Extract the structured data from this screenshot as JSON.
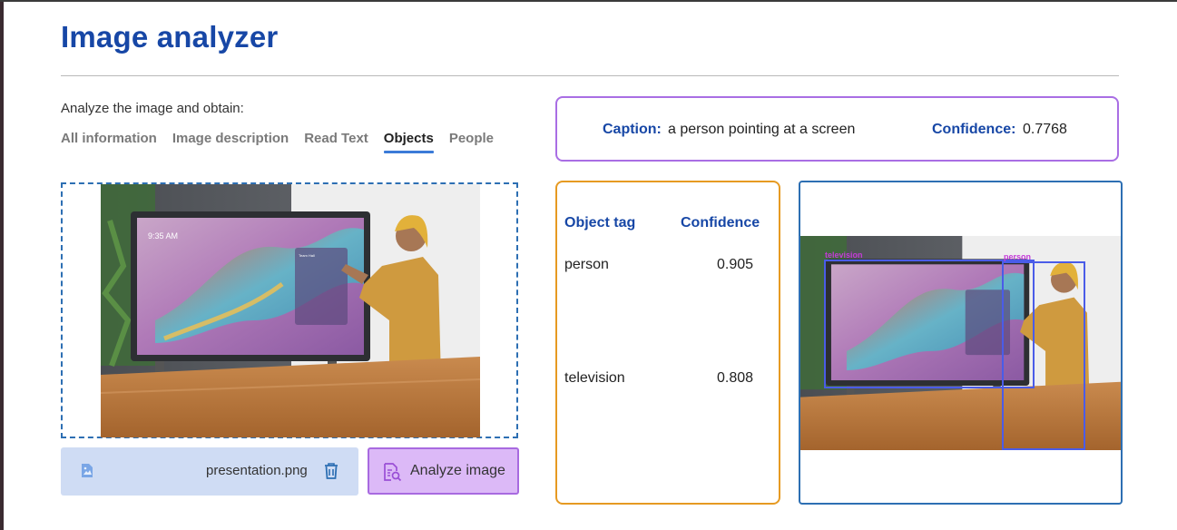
{
  "page": {
    "title": "Image analyzer",
    "intro": "Analyze the image and obtain:"
  },
  "tabs": [
    {
      "label": "All information",
      "active": false
    },
    {
      "label": "Image description",
      "active": false
    },
    {
      "label": "Read Text",
      "active": false
    },
    {
      "label": "Objects",
      "active": true
    },
    {
      "label": "People",
      "active": false
    }
  ],
  "upload": {
    "file_name": "presentation.png",
    "file_icon": "image-file-icon",
    "delete_icon": "trash-icon"
  },
  "analyze_button": {
    "label": "Analyze image",
    "icon": "document-search-icon"
  },
  "caption": {
    "caption_label": "Caption:",
    "caption_value": "a person pointing at a screen",
    "confidence_label": "Confidence:",
    "confidence_value": "0.7768"
  },
  "objects_table": {
    "headers": [
      "Object tag",
      "Confidence"
    ],
    "rows": [
      {
        "tag": "person",
        "confidence": "0.905"
      },
      {
        "tag": "television",
        "confidence": "0.808"
      }
    ]
  },
  "photo_screen": {
    "time": "9:35 AM",
    "panel_title": "Team Hall"
  },
  "detections": [
    {
      "label": "television"
    },
    {
      "label": "person"
    }
  ],
  "colors": {
    "title": "#1747a6",
    "tab_underline": "#3b7bd8",
    "caption_border": "#a96ee4",
    "tags_border": "#e69a22",
    "result_border": "#2d6fb3",
    "bbox": "#4a5ce8",
    "bbox_label": "#c53ad8",
    "analyze_bg": "#dcb9f7",
    "file_bar_bg": "#cfdcf4"
  }
}
